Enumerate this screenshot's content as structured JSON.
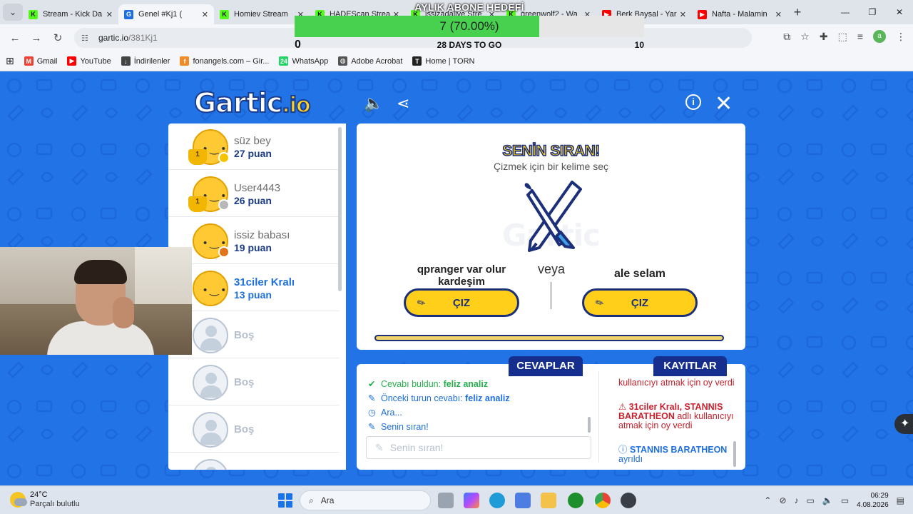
{
  "browser": {
    "tabs": [
      {
        "title": "Stream - Kick Da",
        "favicon": "kick-icon",
        "color": "#53fc18",
        "letter": "K",
        "active": false
      },
      {
        "title": "Genel #Kj1 (",
        "favicon": "gartic-icon",
        "color": "#1e6fe0",
        "letter": "G",
        "active": true
      },
      {
        "title": "Homiev Stream",
        "favicon": "kick-icon",
        "color": "#53fc18",
        "letter": "K",
        "active": false
      },
      {
        "title": "HADEScan Strea",
        "favicon": "kick-icon",
        "color": "#53fc18",
        "letter": "K",
        "active": false
      },
      {
        "title": "issizadalive Stre",
        "favicon": "kick-icon",
        "color": "#53fc18",
        "letter": "K",
        "active": false
      },
      {
        "title": "greenwolf2 - Wa",
        "favicon": "kick-icon",
        "color": "#53fc18",
        "letter": "K",
        "active": false
      },
      {
        "title": "Berk Baysal - Yar",
        "favicon": "youtube-icon",
        "color": "#ff0000",
        "letter": "▶",
        "active": false
      },
      {
        "title": "Nafta - Malamin",
        "favicon": "youtube-icon",
        "color": "#ff0000",
        "letter": "▶",
        "active": false
      }
    ],
    "url_host": "gartic.io",
    "url_path": "/381Kj1",
    "profile_letter": "a",
    "bookmarks": [
      {
        "label": "Gmail",
        "icon": "gmail-icon",
        "color": "#ea4335",
        "glyph": "M"
      },
      {
        "label": "YouTube",
        "icon": "youtube-icon",
        "color": "#ff0000",
        "glyph": "▶"
      },
      {
        "label": "İndirilenler",
        "icon": "download-icon",
        "color": "#444444",
        "glyph": "↓"
      },
      {
        "label": "fonangels.com – Gir...",
        "icon": "fonangels-icon",
        "color": "#f08a24",
        "glyph": "f"
      },
      {
        "label": "WhatsApp",
        "icon": "whatsapp-icon",
        "color": "#25d366",
        "glyph": "24"
      },
      {
        "label": "Adobe Acrobat",
        "icon": "globe-icon",
        "color": "#555555",
        "glyph": "◍"
      },
      {
        "label": "Home | TORN",
        "icon": "torn-icon",
        "color": "#222222",
        "glyph": "T"
      }
    ]
  },
  "goal": {
    "title": "AYLIK ABONE HEDEFİ",
    "value_text": "7 (70.00%)",
    "progress": 0.7,
    "min": "0",
    "max": "10",
    "days": "28 DAYS TO GO"
  },
  "game": {
    "logo_main": "Gartic",
    "logo_suffix": ".io",
    "players": [
      {
        "name": "süz bey",
        "score": "27 puan",
        "rank": "1",
        "dot": "#f5c400",
        "me": false,
        "empty": false
      },
      {
        "name": "User4443",
        "score": "26 puan",
        "rank": "1",
        "dot": "#b8b8b8",
        "me": false,
        "empty": false
      },
      {
        "name": "issiz babası",
        "score": "19 puan",
        "rank": "",
        "dot": "#e0751b",
        "me": false,
        "empty": false
      },
      {
        "name": "31ciler Kralı",
        "score": "13 puan",
        "rank": "",
        "dot": "",
        "me": true,
        "empty": false
      },
      {
        "name": "Boş",
        "score": "",
        "rank": "",
        "dot": "",
        "me": false,
        "empty": true
      },
      {
        "name": "Boş",
        "score": "",
        "rank": "",
        "dot": "",
        "me": false,
        "empty": true
      },
      {
        "name": "Boş",
        "score": "",
        "rank": "",
        "dot": "",
        "me": false,
        "empty": true
      }
    ],
    "turn_title": "SENİN SIRAN!",
    "turn_subtitle": "Çizmek için bir kelime seç",
    "word_left": "qpranger var olur kardeşim",
    "word_right": "ale selam",
    "or_label": "veya",
    "draw_label": "ÇIZ",
    "answers_tab": "CEVAPLAR",
    "logs_tab": "KAYITLAR",
    "answers": [
      {
        "icon": "check-icon",
        "prefix": "Cevabı buldun: ",
        "bold": "feliz analiz",
        "cls": "green"
      },
      {
        "icon": "pencil-icon",
        "prefix": "Önceki turun cevabı: ",
        "bold": "feliz analiz",
        "cls": "blue"
      },
      {
        "icon": "clock-icon",
        "prefix": "Ara...",
        "bold": "",
        "cls": "blue"
      },
      {
        "icon": "pencil-icon",
        "prefix": "Senin sıran!",
        "bold": "",
        "cls": "blue"
      }
    ],
    "chat_placeholder": "Senin sıran!",
    "logs": {
      "line1": "kullanıcıyı atmak için oy verdi",
      "line2_bold": "31ciler Kralı, STANNIS BARATHEON",
      "line2_rest": " adlı kullanıcıyı atmak için oy verdi",
      "line3_bold": "STANNIS BARATHEON",
      "line3_rest": "ayrıldı"
    }
  },
  "taskbar": {
    "temp": "24°C",
    "weather": "Parçalı bulutlu",
    "search": "Ara",
    "time": "06:29",
    "date": "4.08.2026"
  }
}
